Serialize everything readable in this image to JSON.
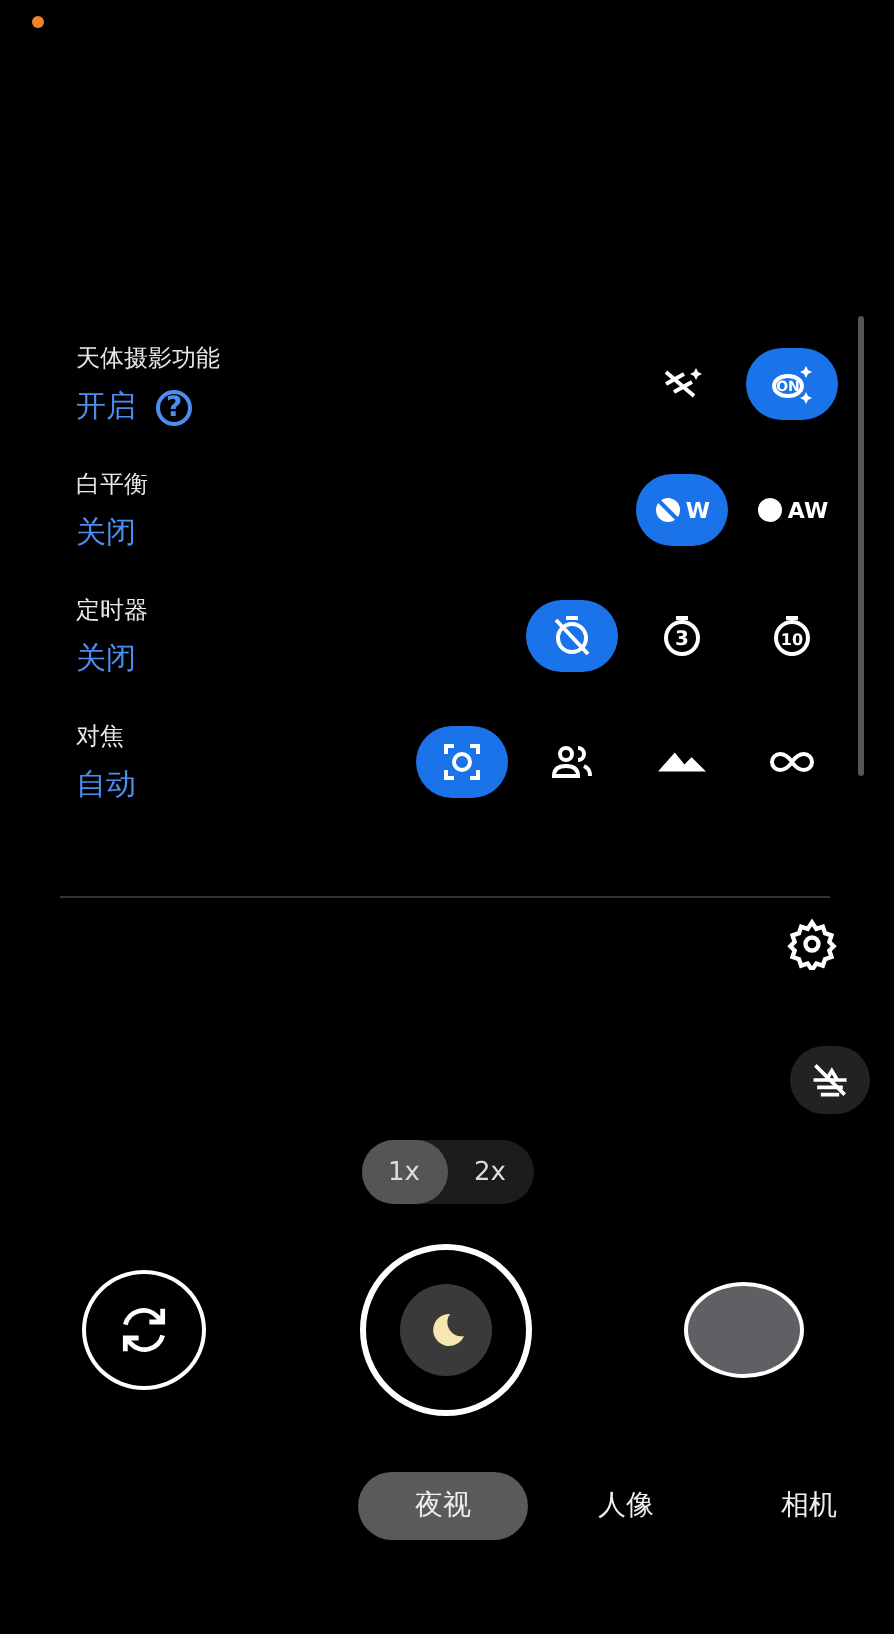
{
  "status_dot": {
    "color": "#f5822a"
  },
  "settings": [
    {
      "label": "天体摄影功能",
      "value": "开启",
      "help": "?",
      "options": [
        {
          "kind": "astro-off",
          "selected": false
        },
        {
          "kind": "astro-on",
          "glyph": "ON",
          "selected": true
        }
      ]
    },
    {
      "label": "白平衡",
      "value": "关闭",
      "options": [
        {
          "kind": "wb-off",
          "glyph": "W",
          "selected": true
        },
        {
          "kind": "wb-auto",
          "glyph": "AW",
          "selected": false
        }
      ]
    },
    {
      "label": "定时器",
      "value": "关闭",
      "options": [
        {
          "kind": "timer-off",
          "selected": true
        },
        {
          "kind": "timer",
          "glyph": "3",
          "selected": false
        },
        {
          "kind": "timer",
          "glyph": "10",
          "selected": false
        }
      ]
    },
    {
      "label": "对焦",
      "value": "自动",
      "options": [
        {
          "kind": "focus-auto",
          "selected": true
        },
        {
          "kind": "focus-people",
          "selected": false
        },
        {
          "kind": "focus-landscape",
          "selected": false
        },
        {
          "kind": "focus-infinity",
          "selected": false
        }
      ]
    }
  ],
  "zoom": [
    {
      "label": "1x",
      "selected": true
    },
    {
      "label": "2x",
      "selected": false
    }
  ],
  "modes": [
    {
      "label": "夜视",
      "selected": true
    },
    {
      "label": "人像",
      "selected": false
    },
    {
      "label": "相机",
      "selected": false
    }
  ]
}
